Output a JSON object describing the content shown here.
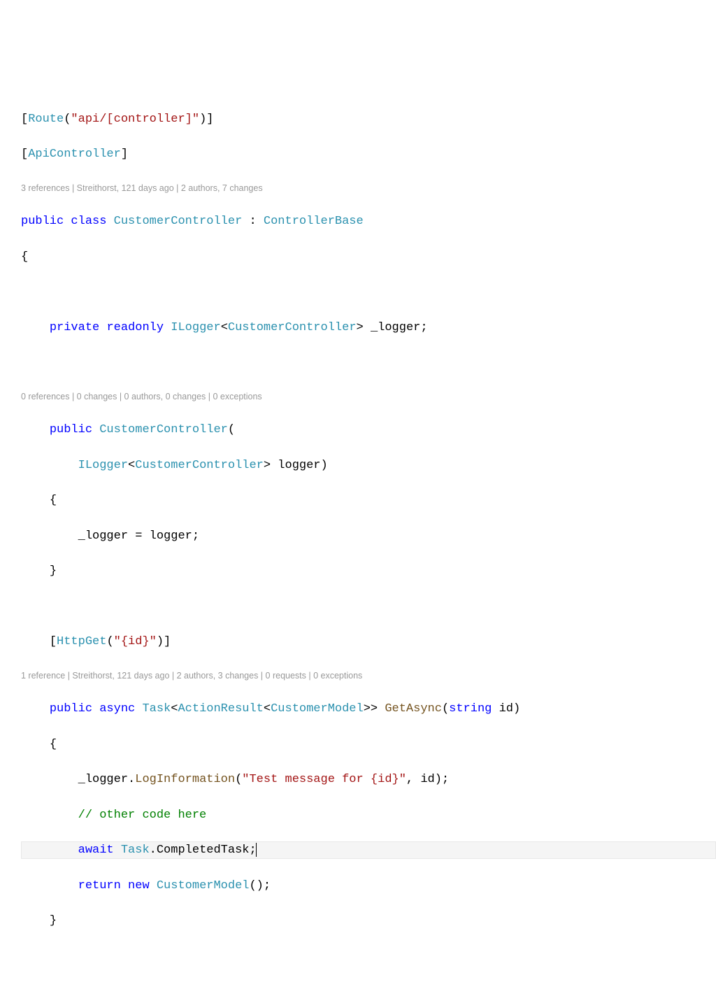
{
  "code": {
    "line1": {
      "br1": "[",
      "attr": "Route",
      "p1": "(",
      "str": "\"api/[controller]\"",
      "p2": ")]"
    },
    "line2": {
      "br1": "[",
      "attr": "ApiController",
      "br2": "]"
    },
    "codelens1": "3 references | Streithorst, 121 days ago | 2 authors, 7 changes",
    "line3": {
      "kw1": "public",
      "kw2": "class",
      "name": "CustomerController",
      "colon": " : ",
      "base": "ControllerBase"
    },
    "line4": "{",
    "line5": {
      "kw1": "private",
      "kw2": "readonly",
      "type": "ILogger",
      "lt": "<",
      "gen": "CustomerController",
      "gt": "> ",
      "field": "_logger;"
    },
    "codelens2": "0 references | 0 changes | 0 authors, 0 changes | 0 exceptions",
    "line6": {
      "kw": "public",
      "ctor": "CustomerController",
      "p": "("
    },
    "line7": {
      "type": "ILogger",
      "lt": "<",
      "gen": "CustomerController",
      "gt": "> ",
      "param": "logger)"
    },
    "line8": "{",
    "line9": "_logger = logger;",
    "line10": "}",
    "line11": {
      "br1": "[",
      "attr": "HttpGet",
      "p1": "(",
      "str": "\"{id}\"",
      "p2": ")]"
    },
    "codelens3": "1 reference | Streithorst, 121 days ago | 2 authors, 3 changes | 0 requests | 0 exceptions",
    "line12": {
      "kw1": "public",
      "kw2": "async",
      "task": "Task",
      "lt1": "<",
      "ar": "ActionResult",
      "lt2": "<",
      "model": "CustomerModel",
      "gt": ">> ",
      "method": "GetAsync",
      "p1": "(",
      "ptype": "string",
      "pname": " id)"
    },
    "line13": "{",
    "line14": {
      "obj": "_logger.",
      "method": "LogInformation",
      "p1": "(",
      "str": "\"Test message for {id}\"",
      "rest": ", id);"
    },
    "line15": "// other code here",
    "line16": {
      "kw": "await",
      "type": "Task",
      "rest": ".CompletedTask;"
    },
    "line17": {
      "kw1": "return",
      "kw2": "new",
      "type": "CustomerModel",
      "rest": "();"
    },
    "line18": "}"
  }
}
